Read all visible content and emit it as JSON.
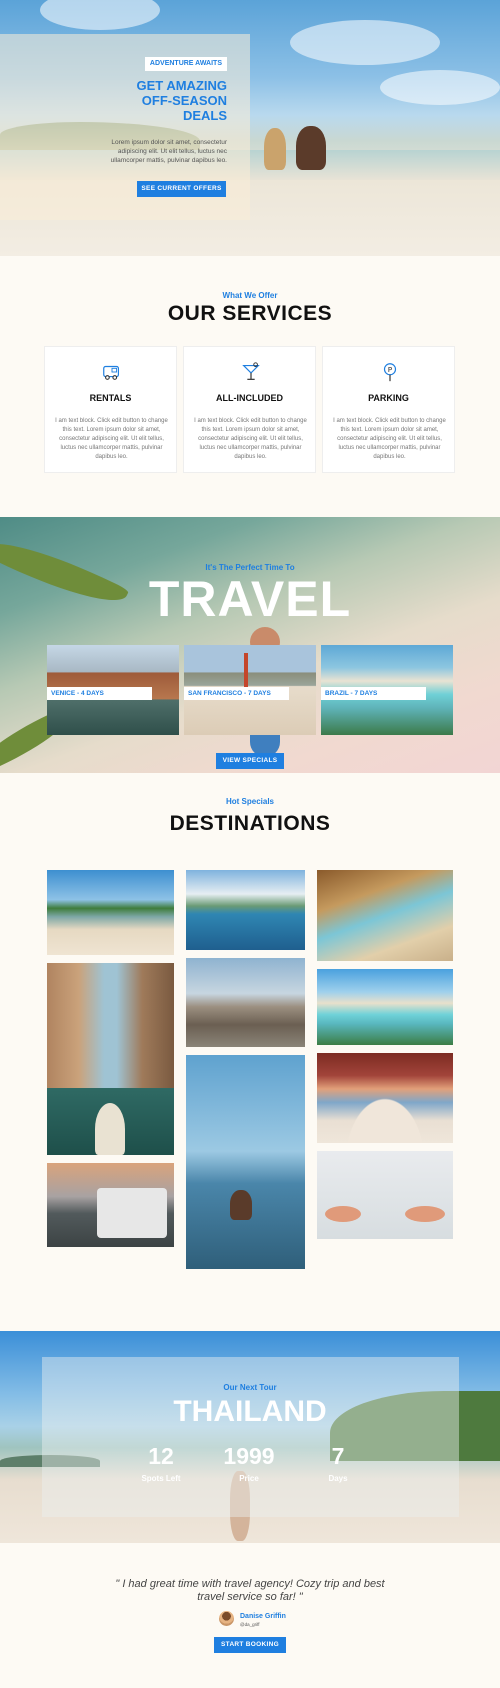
{
  "hero": {
    "tag": "ADVENTURE AWAITS",
    "title": "GET AMAZING OFF-SEASON DEALS",
    "text": "Lorem ipsum dolor sit amet, consectetur adipiscing elit. Ut elit tellus, luctus nec ullamcorper mattis, pulvinar dapibus leo.",
    "button": "SEE CURRENT OFFERS"
  },
  "services": {
    "eyebrow": "What We Offer",
    "title": "OUR SERVICES",
    "cards": [
      {
        "title": "RENTALS",
        "icon": "camper-van-icon",
        "text": "I am text block. Click edit button to change this text. Lorem ipsum dolor sit amet, consectetur adipiscing elit. Ut elit tellus, luctus nec ullamcorper mattis, pulvinar dapibus leo."
      },
      {
        "title": "ALL-INCLUDED",
        "icon": "cocktail-icon",
        "text": "I am text block. Click edit button to change this text. Lorem ipsum dolor sit amet, consectetur adipiscing elit. Ut elit tellus, luctus nec ullamcorper mattis, pulvinar dapibus leo."
      },
      {
        "title": "PARKING",
        "icon": "parking-sign-icon",
        "text": "I am text block. Click edit button to change this text. Lorem ipsum dolor sit amet, consectetur adipiscing elit. Ut elit tellus, luctus nec ullamcorper mattis, pulvinar dapibus leo."
      }
    ]
  },
  "travel": {
    "eyebrow": "It's The Perfect Time To",
    "title": "TRAVEL",
    "destinations": [
      "VENICE - 4 DAYS",
      "SAN FRANCISCO - 7 DAYS",
      "BRAZIL - 7 DAYS"
    ],
    "button": "VIEW SPECIALS"
  },
  "destinations": {
    "eyebrow": "Hot Specials",
    "title": "DESTINATIONS"
  },
  "tour": {
    "eyebrow": "Our Next Tour",
    "title": "THAILAND",
    "stats": [
      {
        "value": "12",
        "label": "Spots Left"
      },
      {
        "value": "1999",
        "label": "Price"
      },
      {
        "value": "7",
        "label": "Days"
      }
    ]
  },
  "testimonial": {
    "quote": "\" I had great time with travel agency! Cozy trip and best travel service so far! \"",
    "name": "Danise Griffin",
    "handle": "@da_griff",
    "button": "START BOOKING"
  },
  "colors": {
    "accent": "#1f7fe0",
    "background": "#fdfaf4"
  }
}
